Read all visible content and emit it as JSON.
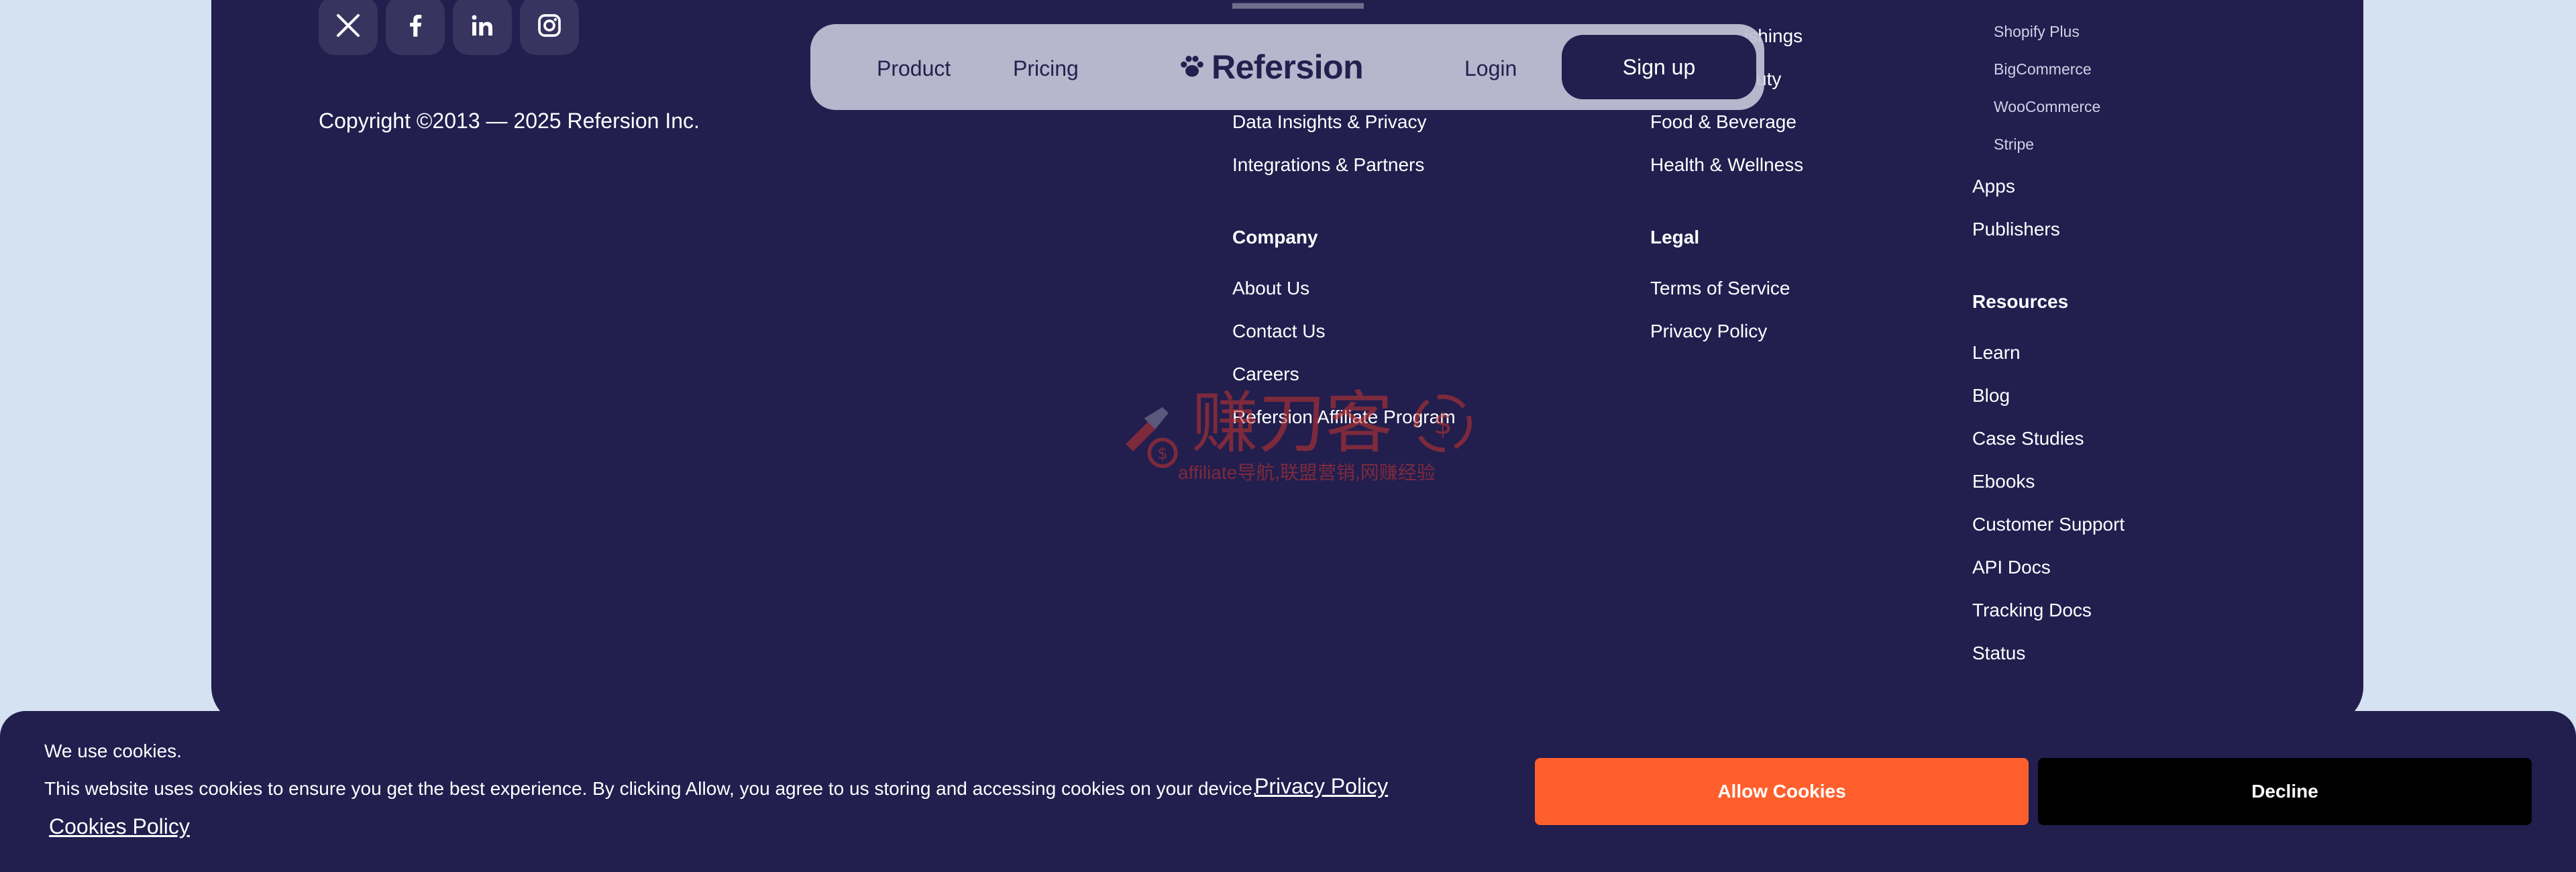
{
  "colors": {
    "page_background": "#d4e2f2",
    "footer_background": "#221e4e",
    "nav_pill_background": "#c4c2d6",
    "accent_orange": "#ff5f2d",
    "decline_black": "#000000",
    "watermark_red": "#c8342f"
  },
  "social": [
    {
      "icon": "x-icon",
      "platform": "X"
    },
    {
      "icon": "facebook-icon",
      "platform": "Facebook"
    },
    {
      "icon": "linkedin-icon",
      "platform": "LinkedIn"
    },
    {
      "icon": "instagram-icon",
      "platform": "Instagram"
    }
  ],
  "copyright": "Copyright ©2013 — 2025 Refersion Inc.",
  "nav": {
    "product": "Product",
    "pricing": "Pricing",
    "logo_icon": "paw-logo-icon",
    "logo_text": "Refersion",
    "login": "Login",
    "signup": "Sign up"
  },
  "footer_col1": {
    "links": [
      "Data Insights & Privacy",
      "Integrations & Partners"
    ],
    "company_heading": "Company",
    "company_links": [
      "About Us",
      "Contact Us",
      "Careers",
      "Refersion Affiliate Program"
    ]
  },
  "footer_col2": {
    "links_partial": [
      "ishings",
      "uty"
    ],
    "links": [
      "Food & Beverage",
      "Health & Wellness"
    ],
    "legal_heading": "Legal",
    "legal_links": [
      "Terms of Service",
      "Privacy Policy"
    ]
  },
  "footer_col3": {
    "sub_links": [
      "Shopify Plus",
      "BigCommerce",
      "WooCommerce",
      "Stripe"
    ],
    "links": [
      "Apps",
      "Publishers"
    ],
    "resources_heading": "Resources",
    "resources_links": [
      "Learn",
      "Blog",
      "Case Studies",
      "Ebooks",
      "Customer Support",
      "API Docs",
      "Tracking Docs",
      "Status"
    ]
  },
  "watermark": {
    "main": "赚刀客",
    "sub": "affiliate导航,联盟营销,网赚经验"
  },
  "cookie_banner": {
    "title": "We use cookies.",
    "text": "This website uses cookies to ensure you get the best experience. By clicking Allow, you agree to us storing and accessing cookies on your device.",
    "privacy_link": "Privacy Policy",
    "cookies_policy_link": "Cookies Policy",
    "allow": "Allow Cookies",
    "decline": "Decline"
  }
}
